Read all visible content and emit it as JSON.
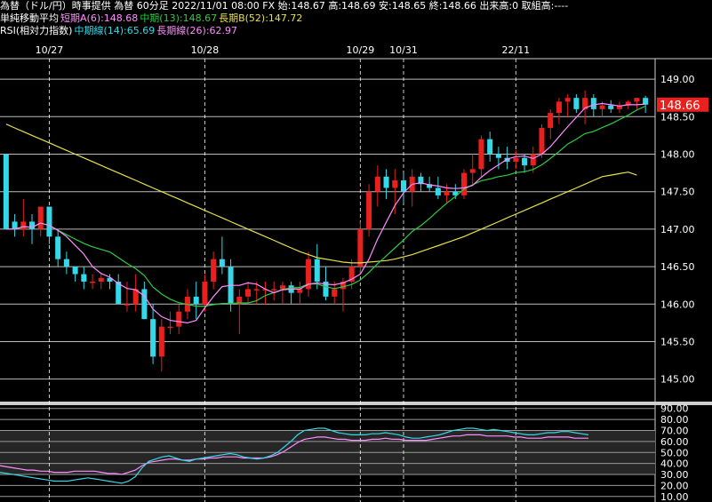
{
  "header": {
    "line1": "為替（ドル/円）時事提供 為替 60分足 2022/11/01 08:00 FX 始:148.67 高:148.69 安:148.65 終:148.66 出来高:0 取組高:----",
    "line2_prefix": "単純移動平均",
    "line2_short": "短期A(6):148.68",
    "line2_mid": "中期(13):148.67",
    "line2_long": "長期B(52):147.72",
    "line3_prefix": "RSI(相対力指数)",
    "line3_mid": "中期線(14):65.69",
    "line3_long": "長期線(26):62.97"
  },
  "colors": {
    "up": "#e8201e",
    "down": "#35d8e8",
    "ma_short": "#ff8cff",
    "ma_mid": "#2ecc40",
    "ma_long": "#e6e04a",
    "rsi_mid": "#35d8e8",
    "rsi_long": "#ff8cff",
    "price_tag": "#e8201e"
  },
  "chart_data": [
    {
      "type": "candlestick",
      "y_ticks": [
        "149.00",
        "148.50",
        "148.00",
        "147.50",
        "147.00",
        "146.50",
        "146.00",
        "145.50",
        "145.00"
      ],
      "ylim": [
        144.7,
        149.25
      ],
      "date_labels": [
        {
          "label": "10/27",
          "index": 5
        },
        {
          "label": "10/28",
          "index": 23
        },
        {
          "label": "10/29",
          "index": 41
        },
        {
          "label": "10/31",
          "index": 46
        },
        {
          "label": "22/11",
          "index": 59
        }
      ],
      "last_price": "148.66",
      "candles": [
        [
          148.0,
          148.0,
          147.1,
          147.0
        ],
        [
          147.1,
          147.2,
          146.9,
          147.0
        ],
        [
          147.0,
          147.4,
          146.9,
          147.1
        ],
        [
          147.1,
          147.2,
          146.8,
          147.0
        ],
        [
          147.0,
          147.3,
          146.9,
          147.3
        ],
        [
          147.3,
          147.3,
          146.8,
          146.9
        ],
        [
          146.9,
          147.0,
          146.5,
          146.6
        ],
        [
          146.6,
          146.7,
          146.4,
          146.5
        ],
        [
          146.5,
          146.5,
          146.3,
          146.4
        ],
        [
          146.4,
          146.5,
          146.2,
          146.3
        ],
        [
          146.3,
          146.4,
          146.2,
          146.3
        ],
        [
          146.3,
          146.4,
          146.2,
          146.35
        ],
        [
          146.35,
          146.4,
          146.2,
          146.3
        ],
        [
          146.3,
          146.4,
          146.0,
          146.0
        ],
        [
          146.0,
          146.3,
          145.9,
          146.0
        ],
        [
          146.0,
          146.4,
          145.9,
          146.2
        ],
        [
          146.2,
          146.3,
          145.8,
          145.8
        ],
        [
          145.8,
          146.0,
          145.2,
          145.3
        ],
        [
          145.3,
          145.8,
          145.1,
          145.7
        ],
        [
          145.7,
          145.9,
          145.6,
          145.7
        ],
        [
          145.7,
          146.0,
          145.6,
          145.9
        ],
        [
          145.9,
          146.2,
          145.8,
          146.1
        ],
        [
          146.1,
          146.3,
          145.8,
          146.0
        ],
        [
          146.0,
          146.4,
          145.9,
          146.3
        ],
        [
          146.3,
          146.7,
          146.2,
          146.6
        ],
        [
          146.6,
          146.9,
          146.4,
          146.5
        ],
        [
          146.5,
          146.6,
          145.9,
          146.0
        ],
        [
          146.0,
          146.2,
          145.6,
          146.1
        ],
        [
          146.1,
          146.3,
          146.0,
          146.2
        ],
        [
          146.2,
          146.3,
          146.0,
          146.2
        ],
        [
          146.2,
          146.3,
          146.0,
          146.2
        ],
        [
          146.2,
          146.3,
          146.05,
          146.2
        ],
        [
          146.2,
          146.3,
          146.0,
          146.25
        ],
        [
          146.25,
          146.3,
          146.0,
          146.15
        ],
        [
          146.15,
          146.3,
          146.0,
          146.2
        ],
        [
          146.2,
          146.7,
          146.1,
          146.6
        ],
        [
          146.6,
          146.8,
          146.2,
          146.3
        ],
        [
          146.3,
          146.5,
          146.05,
          146.1
        ],
        [
          146.1,
          146.3,
          146.0,
          146.2
        ],
        [
          146.2,
          146.35,
          145.9,
          146.3
        ],
        [
          146.3,
          146.6,
          146.2,
          146.5
        ],
        [
          146.5,
          147.1,
          146.4,
          147.0
        ],
        [
          147.0,
          147.6,
          146.9,
          147.5
        ],
        [
          147.5,
          147.85,
          147.3,
          147.7
        ],
        [
          147.7,
          147.8,
          147.4,
          147.55
        ],
        [
          147.55,
          147.8,
          147.2,
          147.65
        ],
        [
          147.65,
          147.75,
          147.35,
          147.5
        ],
        [
          147.5,
          147.8,
          147.3,
          147.7
        ],
        [
          147.7,
          147.75,
          147.5,
          147.6
        ],
        [
          147.6,
          147.7,
          147.5,
          147.55
        ],
        [
          147.55,
          147.7,
          147.4,
          147.45
        ],
        [
          147.45,
          147.6,
          147.35,
          147.5
        ],
        [
          147.5,
          147.6,
          147.4,
          147.45
        ],
        [
          147.45,
          147.8,
          147.4,
          147.75
        ],
        [
          147.75,
          148.0,
          147.6,
          147.8
        ],
        [
          147.8,
          148.25,
          147.7,
          148.2
        ],
        [
          148.2,
          148.3,
          147.9,
          148.0
        ],
        [
          148.0,
          148.1,
          147.8,
          147.95
        ],
        [
          147.95,
          148.1,
          147.8,
          147.9
        ],
        [
          147.9,
          148.05,
          147.8,
          147.95
        ],
        [
          147.95,
          148.0,
          147.75,
          147.85
        ],
        [
          147.85,
          148.1,
          147.75,
          148.0
        ],
        [
          148.0,
          148.4,
          147.95,
          148.35
        ],
        [
          148.35,
          148.6,
          148.2,
          148.55
        ],
        [
          148.55,
          148.75,
          148.4,
          148.7
        ],
        [
          148.7,
          148.8,
          148.5,
          148.75
        ],
        [
          148.75,
          148.8,
          148.55,
          148.6
        ],
        [
          148.6,
          148.85,
          148.4,
          148.75
        ],
        [
          148.75,
          148.8,
          148.5,
          148.6
        ],
        [
          148.6,
          148.7,
          148.5,
          148.65
        ],
        [
          148.65,
          148.72,
          148.55,
          148.6
        ],
        [
          148.6,
          148.7,
          148.55,
          148.65
        ],
        [
          148.65,
          148.72,
          148.6,
          148.7
        ],
        [
          148.7,
          148.75,
          148.6,
          148.75
        ],
        [
          148.75,
          148.78,
          148.55,
          148.66
        ]
      ]
    },
    {
      "type": "line",
      "name": "RSI",
      "y_ticks": [
        "90.00",
        "80.00",
        "70.00",
        "60.00",
        "50.00",
        "40.00",
        "30.00",
        "20.00",
        "10.00"
      ],
      "ylim": [
        5,
        93
      ],
      "bands": [
        [
          30,
          70
        ]
      ],
      "rsi_mid": [
        32,
        31,
        30,
        29,
        28,
        27,
        26,
        25,
        24,
        24,
        24,
        25,
        26,
        27,
        26,
        25,
        24,
        23,
        22,
        24,
        28,
        36,
        42,
        44,
        46,
        47,
        45,
        43,
        42,
        44,
        45,
        46,
        47,
        48,
        49,
        48,
        46,
        45,
        44,
        45,
        47,
        50,
        55,
        60,
        66,
        70,
        71,
        72,
        72,
        70,
        68,
        67,
        66,
        66,
        66,
        67,
        67,
        68,
        67,
        66,
        64,
        63,
        63,
        64,
        65,
        66,
        68,
        70,
        71,
        72,
        72,
        71,
        70,
        71,
        70,
        69,
        68,
        67,
        66,
        66,
        67,
        68,
        68,
        69,
        69,
        68,
        67,
        66
      ],
      "rsi_long": [
        38,
        37,
        36,
        35,
        34,
        34,
        33,
        33,
        32,
        32,
        32,
        33,
        33,
        33,
        33,
        32,
        31,
        31,
        30,
        32,
        34,
        38,
        41,
        42,
        43,
        44,
        44,
        43,
        43,
        44,
        44,
        45,
        45,
        46,
        46,
        46,
        45,
        45,
        45,
        45,
        46,
        48,
        51,
        55,
        59,
        62,
        63,
        64,
        64,
        63,
        62,
        62,
        61,
        61,
        61,
        62,
        62,
        63,
        62,
        62,
        61,
        61,
        61,
        61,
        62,
        63,
        64,
        65,
        65,
        66,
        66,
        66,
        65,
        65,
        65,
        65,
        64,
        64,
        63,
        63,
        63,
        64,
        64,
        64,
        64,
        63,
        63,
        63
      ]
    }
  ]
}
